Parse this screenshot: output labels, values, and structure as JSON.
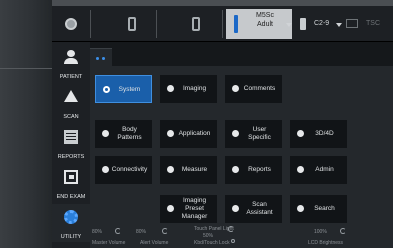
{
  "topbar": {
    "probe_active": {
      "line1": "M5Sc",
      "line2": "Adult"
    },
    "probe2": {
      "label": "C2-9"
    },
    "tsc": {
      "label": "TSC"
    }
  },
  "nav": {
    "items": [
      {
        "label": "PATIENT",
        "icon": "patient-icon"
      },
      {
        "label": "SCAN",
        "icon": "scan-icon"
      },
      {
        "label": "REPORTS",
        "icon": "reports-icon"
      },
      {
        "label": "END EXAM",
        "icon": "end-exam-icon"
      },
      {
        "label": "UTILITY",
        "icon": "utility-gear-icon",
        "active": true
      }
    ]
  },
  "utility_buttons": [
    {
      "label": "System",
      "active": true
    },
    {
      "label": "Imaging"
    },
    {
      "label": "Comments"
    },
    {
      "label": "Body\nPatterns"
    },
    {
      "label": "Application"
    },
    {
      "label": "User\nSpecific"
    },
    {
      "label": "3D/4D"
    },
    {
      "label": "Connectivity"
    },
    {
      "label": "Measure"
    },
    {
      "label": "Reports"
    },
    {
      "label": "Admin"
    },
    {
      "label": "Imaging Preset\nManager"
    },
    {
      "label": "Scan\nAssistant"
    },
    {
      "label": "Search"
    }
  ],
  "status_row": {
    "v1": "80%",
    "v2": "80%",
    "touch_panel_light": "Touch Panel Light",
    "touch_panel_value": "50%",
    "v4": "100%",
    "l1": "Master Volume",
    "l2": "Alert Volume",
    "l3": "Kbd/Touch Lock",
    "l4": "LCD Brightness"
  },
  "colors": {
    "accent": "#1a5faa",
    "active_border": "#3f8fe0",
    "probe_bar": "#1b68c7"
  }
}
